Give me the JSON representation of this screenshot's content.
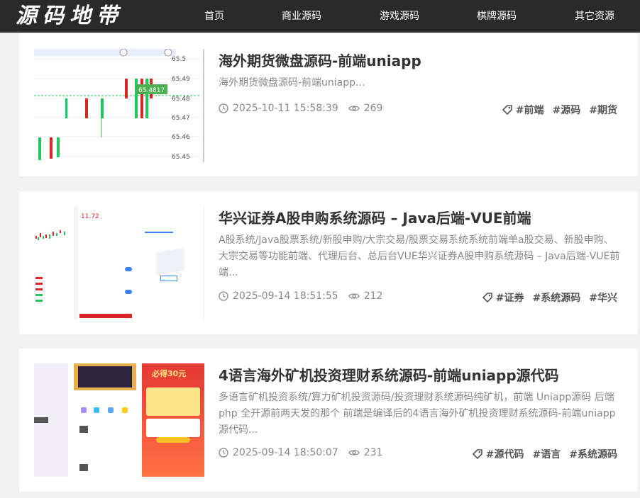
{
  "header": {
    "logo": "源码地带",
    "nav": [
      "首页",
      "商业源码",
      "游戏源码",
      "棋牌源码",
      "其它资源"
    ]
  },
  "colors": {
    "header_bg": "#2a2a2a",
    "green": "#22c55e",
    "red": "#dc2626"
  },
  "posts": [
    {
      "title": "海外期货微盘源码-前端uniapp",
      "desc": "海外期货微盘源码-前端uniapp...",
      "date": "2025-10-11 15:58:39",
      "views": "269",
      "tags": [
        "#前端",
        "#源码",
        "#期货"
      ],
      "thumb": {
        "axis_labels": [
          "65.5",
          "65.49",
          "65.48",
          "65.47",
          "65.46",
          "65.45"
        ],
        "price_badge": "65.4817"
      }
    },
    {
      "title": "华兴证券A股申购系统源码 – Java后端-VUE前端",
      "desc": "A股系统/Java股票系统/新股申购/大宗交易/股票交易系统系统前端单a股交易、新股申购、大宗交易等功能前端、代理后台、总后台VUE华兴证券A股申购系统源码 – Java后端-VUE前端...",
      "date": "2025-09-14 18:51:55",
      "views": "212",
      "tags": [
        "#证券",
        "#系统源码",
        "#华兴"
      ],
      "thumb": {
        "value": "11.72"
      }
    },
    {
      "title": "4语言海外矿机投资理财系统源码-前端uniapp源代码",
      "desc": "多语言矿机投资系统/算力矿机投资源码/投资理财系统源码纯矿机，前端 Uniapp源码 后端php 全开源前两天发的那个 前端是编译后的4语言海外矿机投资理财系统源码-前端uniapp源代码...",
      "date": "2025-09-14 18:50:07",
      "views": "231",
      "tags": [
        "#源代码",
        "#语言",
        "#系统源码"
      ],
      "thumb": {
        "promo": "必得30元"
      }
    }
  ]
}
